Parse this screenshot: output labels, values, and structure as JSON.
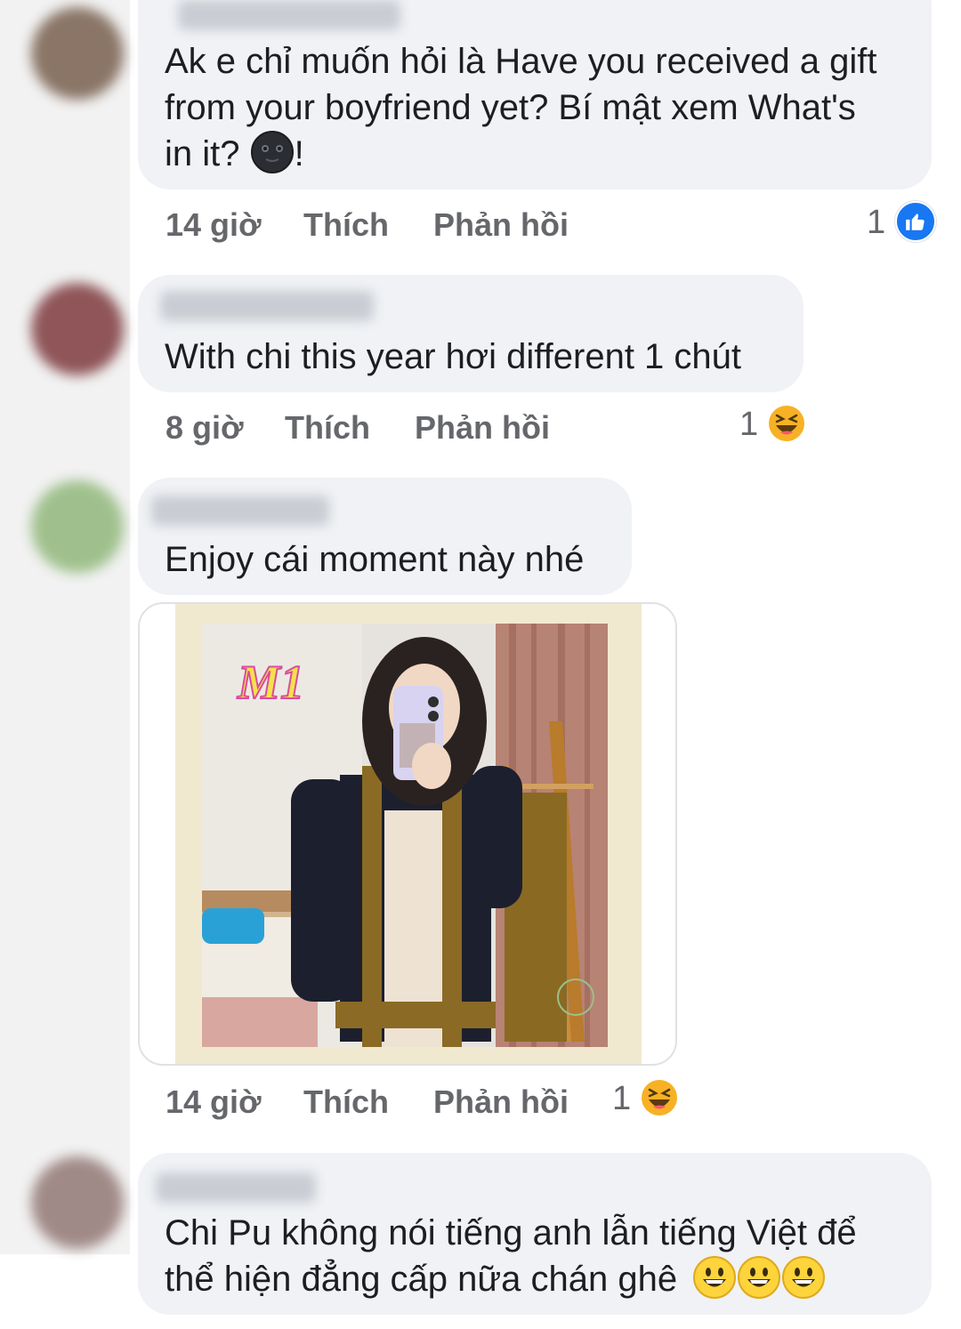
{
  "comments": [
    {
      "text_lines": [
        "Ak e chỉ muốn hỏi là Have you received a gift",
        "from your boyfriend yet? Bí mật xem What's",
        "in it?"
      ],
      "trailing_punct": "!",
      "inline_emoji": "new-moon-face",
      "time": "14 giờ",
      "like_label": "Thích",
      "reply_label": "Phản hồi",
      "reaction_count": "1",
      "reaction_icon": "like-icon"
    },
    {
      "text_lines": [
        "With chi this year hơi different 1 chút"
      ],
      "time": "8 giờ",
      "like_label": "Thích",
      "reply_label": "Phản hồi",
      "reaction_count": "1",
      "reaction_icon": "laugh-icon"
    },
    {
      "text_lines": [
        "Enjoy cái moment này nhé"
      ],
      "attachment_label": "M1",
      "time": "14 giờ",
      "like_label": "Thích",
      "reply_label": "Phản hồi",
      "reaction_count": "1",
      "reaction_icon": "laugh-icon"
    },
    {
      "text_lines": [
        "Chi Pu không nói tiếng anh lẫn tiếng Việt để",
        "thể hiện đẳng cấp nữa chán ghê"
      ],
      "inline_emoji": "grinning-face x3"
    }
  ],
  "colors": {
    "bubble": "#f0f2f5",
    "meta_text": "#65676b",
    "like_blue": "#1877f2",
    "emoji_yellow": "#f7b125"
  }
}
